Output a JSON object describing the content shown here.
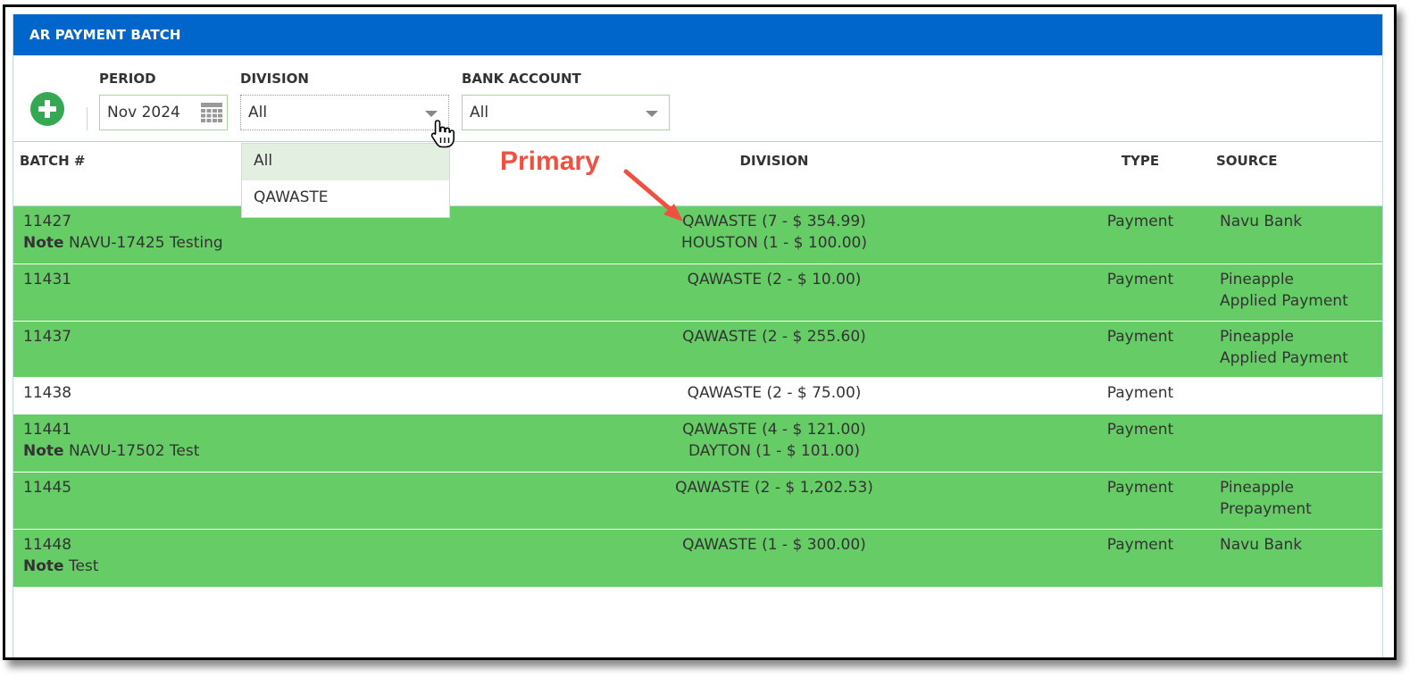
{
  "window": {
    "title": "AR PAYMENT BATCH"
  },
  "filters": {
    "period": {
      "label": "PERIOD",
      "value": "Nov 2024"
    },
    "division": {
      "label": "DIVISION",
      "value": "All",
      "options": [
        "All",
        "QAWASTE"
      ]
    },
    "bank_account": {
      "label": "BANK ACCOUNT",
      "value": "All"
    }
  },
  "columns": {
    "batch": "BATCH #",
    "division": "DIVISION",
    "type": "TYPE",
    "source": "SOURCE"
  },
  "annotation": {
    "text": "Primary",
    "color": "#ef5040"
  },
  "note_label": "Note",
  "rows": [
    {
      "batch": "11427",
      "note": "NAVU-17425 Testing",
      "divisions": [
        "QAWASTE (7 - $ 354.99)",
        "HOUSTON (1 - $ 100.00)"
      ],
      "type": "Payment",
      "source": [
        "Navu Bank"
      ],
      "highlight": true
    },
    {
      "batch": "11431",
      "note": "",
      "divisions": [
        "QAWASTE (2 - $ 10.00)"
      ],
      "type": "Payment",
      "source": [
        "Pineapple",
        "Applied Payment"
      ],
      "highlight": true
    },
    {
      "batch": "11437",
      "note": "",
      "divisions": [
        "QAWASTE (2 - $ 255.60)"
      ],
      "type": "Payment",
      "source": [
        "Pineapple",
        "Applied Payment"
      ],
      "highlight": true
    },
    {
      "batch": "11438",
      "note": "",
      "divisions": [
        "QAWASTE (2 - $ 75.00)"
      ],
      "type": "Payment",
      "source": [],
      "highlight": false
    },
    {
      "batch": "11441",
      "note": "NAVU-17502 Test",
      "divisions": [
        "QAWASTE (4 - $ 121.00)",
        "DAYTON (1 - $ 101.00)"
      ],
      "type": "Payment",
      "source": [],
      "highlight": true
    },
    {
      "batch": "11445",
      "note": "",
      "divisions": [
        "QAWASTE (2 - $ 1,202.53)"
      ],
      "type": "Payment",
      "source": [
        "Pineapple",
        "Prepayment"
      ],
      "highlight": true
    },
    {
      "batch": "11448",
      "note": "Test",
      "divisions": [
        "QAWASTE (1 - $ 300.00)"
      ],
      "type": "Payment",
      "source": [
        "Navu Bank"
      ],
      "highlight": true
    }
  ],
  "colors": {
    "header": "#0066cc",
    "highlight_row": "#66cc66",
    "add_button": "#34a853"
  },
  "icons": {
    "add": "plus-circle-icon",
    "calendar": "calendar-icon",
    "cursor": "hand-pointer-icon"
  }
}
